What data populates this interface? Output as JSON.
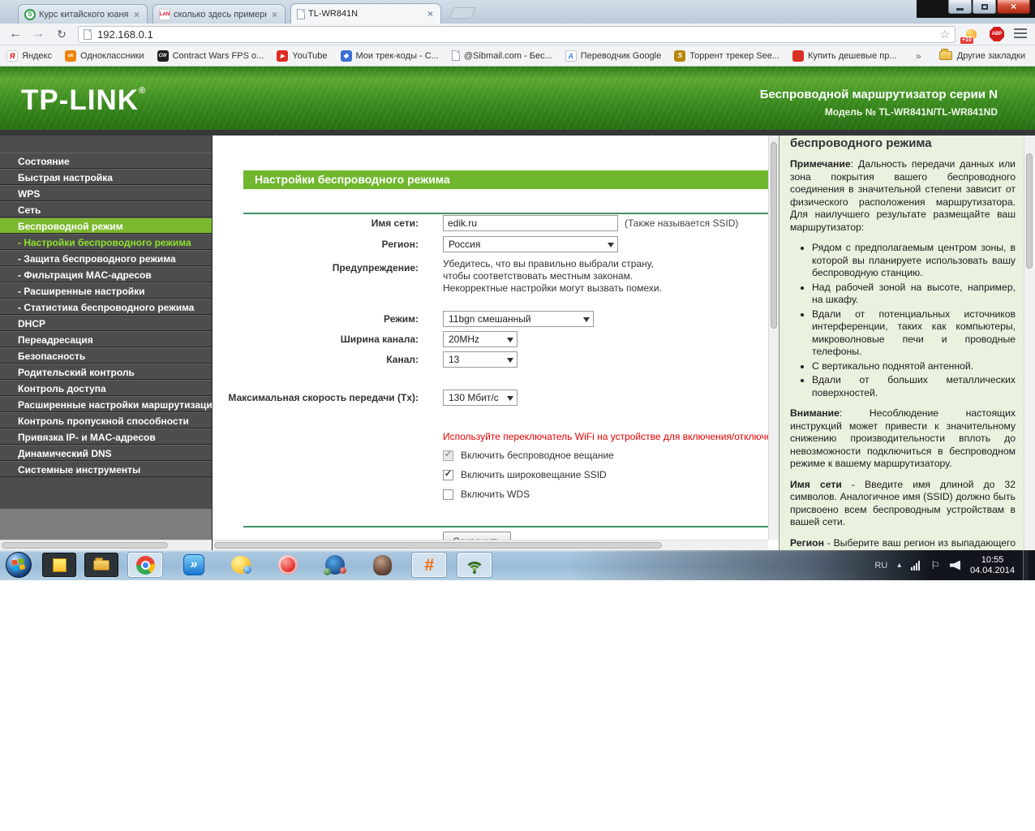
{
  "colors": {
    "brand_green": "#3c8c1f",
    "accent_green": "#6fb72d",
    "sidebar_selected_green": "#7cb82e",
    "active_link_green": "#8ee32b",
    "warning_red": "#e60000",
    "help_background": "#e9f1df"
  },
  "icons": {
    "close_small": "×",
    "window_close": "×",
    "back": "←",
    "forward": "→",
    "reload": "↻",
    "star": "☆",
    "check": "✓",
    "hidden_icons_arrow": "▴",
    "tray_flag": "⚐",
    "download_master_glyph": "»",
    "sharp_glyph": "#"
  },
  "browser": {
    "tabs": [
      {
        "title": "Курс китайского юаня к",
        "favicon_glyph": "S"
      },
      {
        "title": "сколько здесь примерно",
        "favicon_glyph": "LAN"
      },
      {
        "title": "TL-WR841N",
        "favicon_glyph": ""
      }
    ],
    "url": "192.168.0.1",
    "extensions": [
      {
        "name": "weather-extension",
        "badge": "+10"
      },
      {
        "name": "adblock-plus",
        "label": "ABP"
      }
    ],
    "bookmarks": [
      {
        "label": "Яндекс",
        "glyph": "Я"
      },
      {
        "label": "Одноклассники",
        "glyph": "ok"
      },
      {
        "label": "Contract Wars FPS o...",
        "glyph": "CW"
      },
      {
        "label": "YouTube",
        "glyph": "▶"
      },
      {
        "label": "Мои трек-коды - С...",
        "glyph": "◆"
      },
      {
        "label": "@Sibmail.com - Бес...",
        "glyph": ""
      },
      {
        "label": "Переводчик Google",
        "glyph": "A"
      },
      {
        "label": "Торрент трекер See...",
        "glyph": "S"
      },
      {
        "label": "Купить дешевые пр...",
        "glyph": ""
      }
    ],
    "bookmarks_overflow": "»",
    "other_bookmarks": "Другие закладки"
  },
  "router": {
    "header": {
      "logo": "TP-LINK",
      "logo_reg": "®",
      "subtitle": "Беспроводной маршрутизатор серии N",
      "model": "Модель № TL-WR841N/TL-WR841ND"
    },
    "sidebar": {
      "items": [
        {
          "label": "Состояние"
        },
        {
          "label": "Быстрая настройка"
        },
        {
          "label": "WPS"
        },
        {
          "label": "Сеть"
        },
        {
          "label": "Беспроводной режим"
        },
        {
          "label": "- Настройки беспроводного режима"
        },
        {
          "label": "- Защита беспроводного режима"
        },
        {
          "label": "- Фильтрация MAC-адресов"
        },
        {
          "label": "- Расширенные настройки"
        },
        {
          "label": "- Статистика беспроводного режима"
        },
        {
          "label": "DHCP"
        },
        {
          "label": "Переадресация"
        },
        {
          "label": "Безопасность"
        },
        {
          "label": "Родительский контроль"
        },
        {
          "label": "Контроль доступа"
        },
        {
          "label": "Расширенные настройки маршрутизации"
        },
        {
          "label": "Контроль пропускной способности"
        },
        {
          "label": "Привязка IP- и MAC-адресов"
        },
        {
          "label": "Динамический DNS"
        },
        {
          "label": "Системные инструменты"
        }
      ]
    },
    "main": {
      "title": "Настройки беспроводного режима",
      "ssid": {
        "label": "Имя сети:",
        "value": "edik.ru",
        "note": "(Также называется SSID)"
      },
      "region": {
        "label": "Регион:",
        "value": "Россия"
      },
      "warning": {
        "label": "Предупреждение:",
        "text": "Убедитесь, что вы правильно выбрали страну,\nчтобы соответствовать местным законам.\nНекорректные настройки могут вызвать помехи."
      },
      "mode": {
        "label": "Режим:",
        "value": "11bgn смешанный"
      },
      "channel_width": {
        "label": "Ширина канала:",
        "value": "20MHz"
      },
      "channel": {
        "label": "Канал:",
        "value": "13"
      },
      "tx_rate": {
        "label": "Максимальная скорость передачи (Tx):",
        "value": "130 Мбит/с"
      },
      "wifi_switch_note": "Используйте переключатель WiFi на устройстве для включения/отключения",
      "checkboxes": [
        {
          "label": "Включить беспроводное вещание",
          "checked": true,
          "disabled": true
        },
        {
          "label": "Включить широковещание SSID",
          "checked": true,
          "disabled": false
        },
        {
          "label": "Включить WDS",
          "checked": false,
          "disabled": false
        }
      ],
      "save_label": "Сохранить"
    },
    "help": {
      "heading": "беспроводного режима",
      "note_label": "Примечание",
      "note_text": ": Дальность передачи данных или зона покрытия вашего беспроводного соединения в значительной степени зависит от физического расположения маршрутизатора. Для наилучшего результате размещайте ваш маршрутизатор:",
      "bullets": [
        "Рядом с предполагаемым центром зоны, в которой вы планируете использовать вашу беспроводную станцию.",
        "Над рабочей зоной на высоте, например, на шкафу.",
        "Вдали от потенциальных источников интерференции, таких как компьютеры, микроволновые печи и проводные телефоны.",
        "С вертикально поднятой антенной.",
        "Вдали от больших металлических поверхностей."
      ],
      "attention_label": "Внимание",
      "attention_text": ": Несоблюдение настоящих инструкций может привести к значительному снижению производительности вплоть до невозможности подключиться в беспроводном режиме к вашему маршрутизатору.",
      "name_label": "Имя сети",
      "name_text": " - Введите имя длиной до 32 символов. Аналогичное имя (SSID) должно быть присвоено всем беспроводным устройствам в вашей сети.",
      "region_label": "Регион",
      "region_text": " - Выберите ваш регион из выпадающего списка. В данном поле указаны регионы, в которых разрешается использование беспроводной функции маршрутизатора. Следует помнить, что использование беспроводной функции маршрутизатора в регионе, который не"
    }
  },
  "taskbar": {
    "tray": {
      "lang": "RU",
      "time": "10:55",
      "date": "04.04.2014"
    }
  }
}
